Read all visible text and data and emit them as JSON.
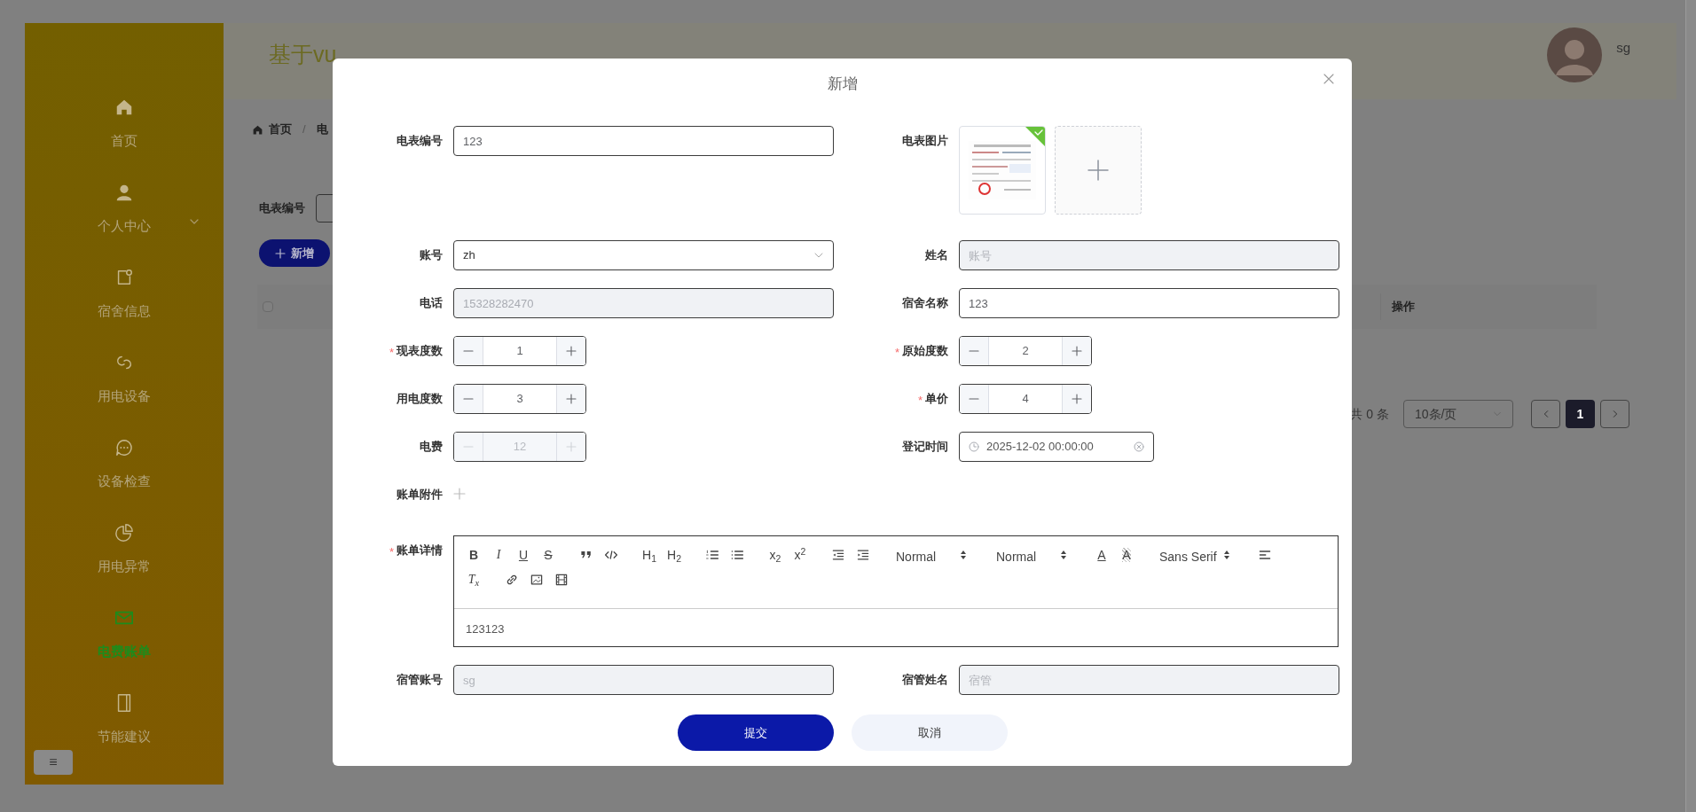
{
  "sidebar": {
    "items": [
      {
        "label": "首页",
        "selected": false,
        "has_children": false
      },
      {
        "label": "个人中心",
        "selected": false,
        "has_children": true
      },
      {
        "label": "宿舍信息",
        "selected": false,
        "has_children": false
      },
      {
        "label": "用电设备",
        "selected": false,
        "has_children": false
      },
      {
        "label": "设备检查",
        "selected": false,
        "has_children": false
      },
      {
        "label": "用电异常",
        "selected": false,
        "has_children": false
      },
      {
        "label": "电费账单",
        "selected": true,
        "has_children": false
      },
      {
        "label": "节能建议",
        "selected": false,
        "has_children": false
      }
    ],
    "collapse_button": "≡"
  },
  "header": {
    "title": "基于vu",
    "user": "sg"
  },
  "breadcrumb": {
    "items": [
      "首页",
      "电"
    ],
    "separator": "/"
  },
  "search": {
    "label": "电表编号"
  },
  "add_button": "新增",
  "table": {
    "select_all": {
      "checked": false
    },
    "columns": [
      "操作"
    ]
  },
  "pagination": {
    "total": "共 0 条",
    "page_size": "10条/页",
    "pages": [
      {
        "label": "1",
        "selected": true
      }
    ]
  },
  "dialog": {
    "title": "新增",
    "rows": [
      {
        "fields": [
          {
            "kind": "text",
            "label": "电表编号",
            "disabled": false,
            "value": "123"
          },
          {
            "kind": "images",
            "label": "电表图片",
            "images": [
              {
                "kind": "picture",
                "uploaded": true
              }
            ]
          }
        ]
      },
      {
        "fields": [
          {
            "kind": "select",
            "label": "账号",
            "disabled": false,
            "value": "zh"
          },
          {
            "kind": "text",
            "label": "姓名",
            "disabled": true,
            "placeholder": "账号"
          }
        ]
      },
      {
        "fields": [
          {
            "kind": "text",
            "label": "电话",
            "disabled": true,
            "value": "15328282470"
          },
          {
            "kind": "text",
            "label": "宿舍名称",
            "disabled": false,
            "value": "123"
          }
        ]
      },
      {
        "fields": [
          {
            "kind": "number",
            "label": "现表度数",
            "required_mark": "*",
            "disabled": false,
            "value": "1"
          },
          {
            "kind": "number",
            "label": "原始度数",
            "required_mark": "*",
            "disabled": false,
            "value": "2"
          }
        ]
      },
      {
        "fields": [
          {
            "kind": "number",
            "label": "用电度数",
            "disabled": false,
            "value": "3"
          },
          {
            "kind": "number",
            "label": "单价",
            "required_mark": "*",
            "disabled": false,
            "value": "4"
          }
        ]
      },
      {
        "fields": [
          {
            "kind": "number",
            "label": "电费",
            "disabled": true,
            "value": "12"
          },
          {
            "kind": "datetime",
            "label": "登记时间",
            "disabled": false,
            "value": "2025-12-02 00:00:00"
          }
        ]
      },
      {
        "fields": [
          {
            "kind": "upload",
            "label": "账单附件"
          }
        ]
      },
      {
        "fields": [
          {
            "kind": "editor",
            "label": "账单详情",
            "required_mark": "*",
            "content": "123123",
            "toolbar_rows": [
              [
                [
                  {
                    "kind": "text",
                    "text": "B"
                  },
                  {
                    "kind": "text",
                    "text": "I"
                  },
                  {
                    "kind": "text",
                    "text": "U"
                  },
                  {
                    "kind": "text",
                    "text": "S"
                  }
                ],
                [
                  {
                    "kind": "icon"
                  },
                  {
                    "kind": "icon"
                  }
                ],
                [
                  {
                    "kind": "text",
                    "text": "H$_{1}$"
                  },
                  {
                    "kind": "text",
                    "text": "H$_{2}$"
                  }
                ],
                [
                  {
                    "kind": "icon"
                  },
                  {
                    "kind": "icon"
                  }
                ],
                [
                  {
                    "kind": "text",
                    "text": "x$_{2}$"
                  },
                  {
                    "kind": "text",
                    "text": "x$^{2}$"
                  }
                ],
                [
                  {
                    "kind": "icon"
                  },
                  {
                    "kind": "icon"
                  }
                ],
                [
                  {
                    "kind": "picker",
                    "text": "Normal"
                  }
                ],
                [
                  {
                    "kind": "picker",
                    "text": "Normal"
                  }
                ],
                [
                  {
                    "kind": "text",
                    "text": "A"
                  },
                  {
                    "kind": "text",
                    "text": "A"
                  }
                ],
                [
                  {
                    "kind": "picker",
                    "text": "Sans Serif"
                  }
                ],
                [
                  {
                    "kind": "icon"
                  }
                ]
              ],
              [
                [
                  {
                    "kind": "text",
                    "text": "T$_{x}$"
                  }
                ],
                [
                  {
                    "kind": "icon"
                  },
                  {
                    "kind": "icon"
                  },
                  {
                    "kind": "icon"
                  }
                ]
              ]
            ]
          }
        ]
      },
      {
        "fields": [
          {
            "kind": "text",
            "label": "宿管账号",
            "disabled": true,
            "placeholder": "sg"
          },
          {
            "kind": "text",
            "label": "宿管姓名",
            "disabled": true,
            "placeholder": "宿管"
          }
        ]
      }
    ],
    "buttons": [
      {
        "label": "提交",
        "kind": "primary"
      },
      {
        "label": "取消",
        "kind": "default"
      }
    ]
  }
}
